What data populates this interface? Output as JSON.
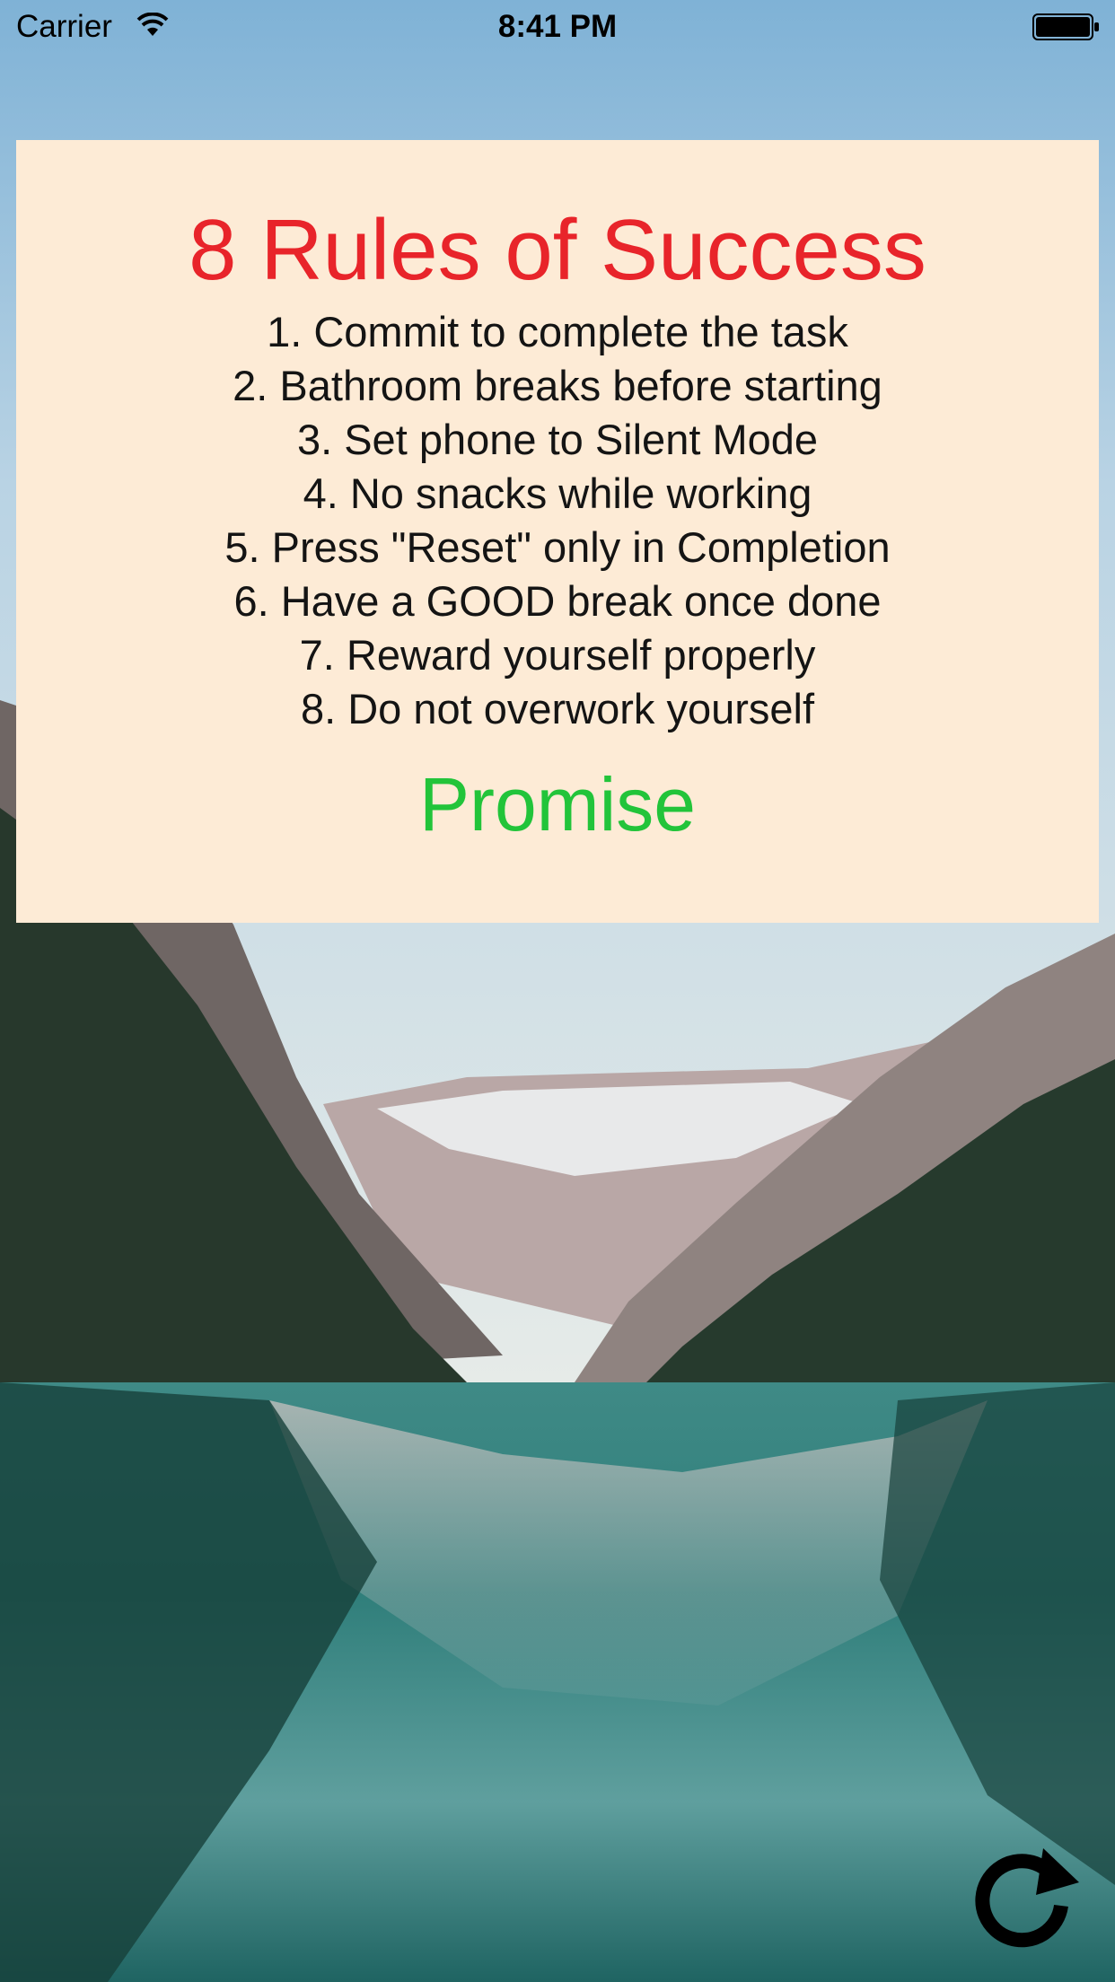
{
  "status_bar": {
    "carrier": "Carrier",
    "time": "8:41 PM",
    "wifi_icon": "wifi-icon",
    "battery_icon": "battery-icon"
  },
  "card": {
    "title": "8 Rules of Success",
    "rules": [
      "1. Commit to complete the task",
      "2. Bathroom breaks before starting",
      "3. Set phone to Silent Mode",
      "4. No snacks while working",
      "5. Press \"Reset\" only in Completion",
      "6. Have a GOOD break once done",
      "7. Reward yourself properly",
      "8. Do not overwork yourself"
    ],
    "promise_label": "Promise"
  },
  "reset": {
    "icon": "refresh-icon"
  },
  "colors": {
    "title": "#e8242a",
    "promise": "#22c43a",
    "card_background": "#fdebd6",
    "rule_text": "#141414"
  }
}
